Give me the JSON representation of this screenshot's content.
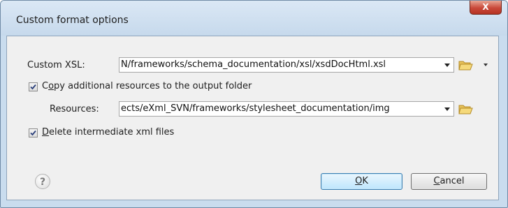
{
  "window": {
    "title": "Custom format options",
    "close_glyph": "X"
  },
  "custom_xsl": {
    "label": "Custom XSL:",
    "value": "N/frameworks/schema_documentation/xsl/xsdDocHtml.xsl"
  },
  "copy_resources": {
    "checked": true,
    "label_mnemonic": "o",
    "label_prefix": "C",
    "label_rest": "py additional resources to the output folder"
  },
  "resources": {
    "label": "Resources:",
    "value": "ects/eXml_SVN/frameworks/stylesheet_documentation/img"
  },
  "delete_intermediate": {
    "checked": true,
    "label_mnemonic": "D",
    "label_rest": "elete intermediate xml files"
  },
  "buttons": {
    "help_glyph": "?",
    "ok_mnemonic": "O",
    "ok_rest": "K",
    "cancel_mnemonic": "C",
    "cancel_rest": "ancel"
  },
  "icons": {
    "folder": "folder-open-icon",
    "dropdown": "chevron-down-icon",
    "check": "checkmark-icon",
    "help": "help-icon",
    "close": "close-icon"
  },
  "colors": {
    "frame": "#c9dcee",
    "client": "#f0f0f0",
    "close_red": "#c9493a",
    "default_button": "#bee6fd"
  }
}
